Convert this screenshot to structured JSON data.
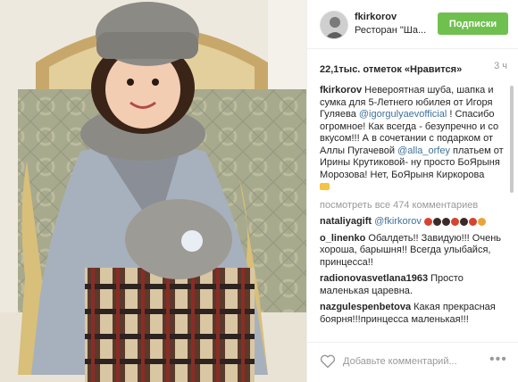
{
  "header": {
    "username": "fkirkorov",
    "location": "Ресторан \"Ша...",
    "follow_label": "Подписки"
  },
  "likes": {
    "text": "22,1тыс. отметок «Нравится»",
    "age": "3 ч"
  },
  "caption": {
    "user": "fkirkorov",
    "part1": "Невероятная шуба, шапка и сумка для 5-Летнего юбилея от Игоря Гуляева",
    "mention1": "@igorgulyaevofficial",
    "part2": "! Спасибо огромное! Как всегда - безупречно и со вкусом!!! А в сочетании с подарком от Аллы Пугачевой",
    "mention2": "@alla_orfey",
    "part3": "платьем от Ирины Крутиковой- ну просто БоЯрыня Морозова! Нет, БоЯрыня Киркорова"
  },
  "view_all": "посмотреть все 474 комментариев",
  "comments": [
    {
      "user": "nataliyagift",
      "mention": "@fkirkorov",
      "text": ""
    },
    {
      "user": "o_linenko",
      "text": "Обалдеть!! Завидую!!! Очень хороша, барышня!! Всегда улыбайся, принцесса!!"
    },
    {
      "user": "radionovasvetlana1963",
      "text": "Просто маленькая царевна."
    },
    {
      "user": "nazgulespenbetova",
      "text": "Какая прекрасная боярня!!!принцесса маленькая!!!"
    }
  ],
  "footer": {
    "placeholder": "Добавьте комментарий...",
    "more": "•••"
  },
  "colors": {
    "follow": "#70c050",
    "link": "#3f729b",
    "muted": "#999999"
  }
}
